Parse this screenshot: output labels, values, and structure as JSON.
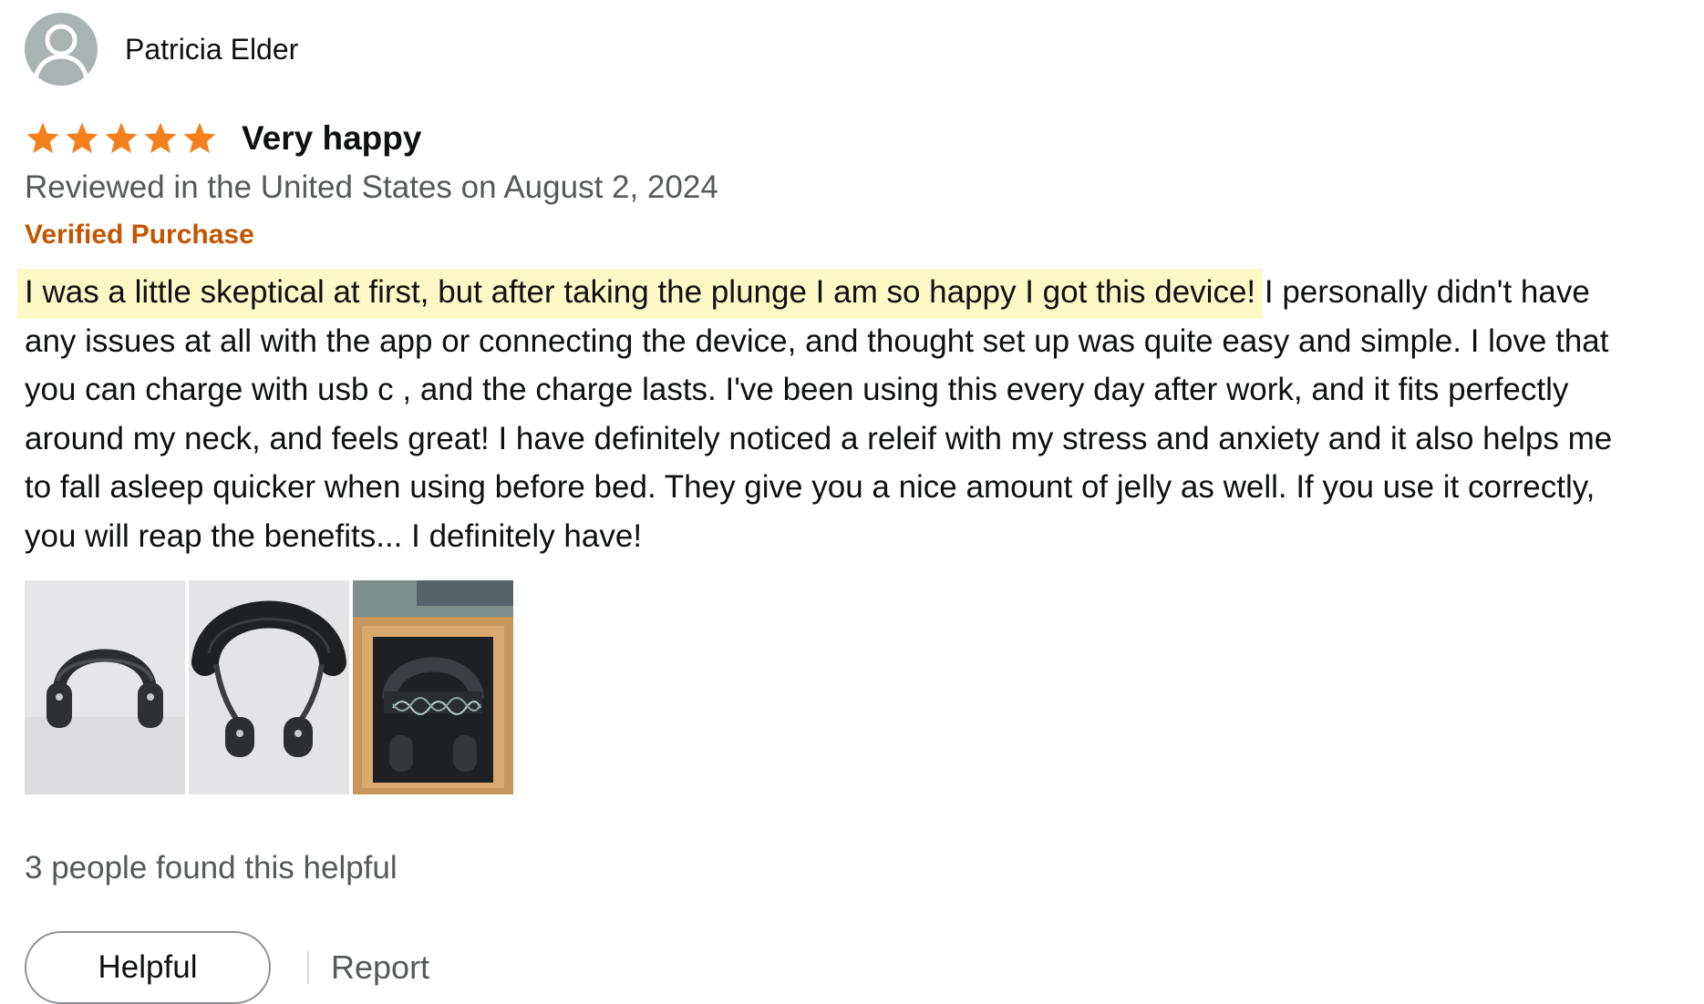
{
  "reviewer": {
    "name": "Patricia Elder",
    "avatar_icon": "default-user-avatar-icon"
  },
  "review": {
    "rating": 5,
    "rating_max": 5,
    "star_color": "#f3801d",
    "title": "Very happy",
    "date_text": "Reviewed in the United States on August 2, 2024",
    "verified_label": "Verified Purchase",
    "verified_color": "#c45500",
    "body_highlighted": "I was a little skeptical at first, but after taking the plunge I am so happy I got this device!",
    "body_rest": " I personally didn't have any issues at all with the app or connecting the device, and thought set up was quite easy and simple. I love that you can charge with usb c , and the charge lasts. I've been using this every day after work, and it fits perfectly around my neck, and feels great! I have definitely noticed a releif with my stress and anxiety and it also helps me to fall asleep quicker when using before bed. They give you a nice amount of jelly as well. If you use it correctly, you will reap the benefits... I definitely have!",
    "highlight_color": "#fdf8c6",
    "images": [
      {
        "depicts": "neck-device-on-white-background"
      },
      {
        "depicts": "neck-device-with-padded-band"
      },
      {
        "depicts": "neck-device-in-open-box"
      }
    ]
  },
  "footer": {
    "helpful_count_text": "3 people found this helpful",
    "helpful_button_label": "Helpful",
    "report_label": "Report"
  }
}
